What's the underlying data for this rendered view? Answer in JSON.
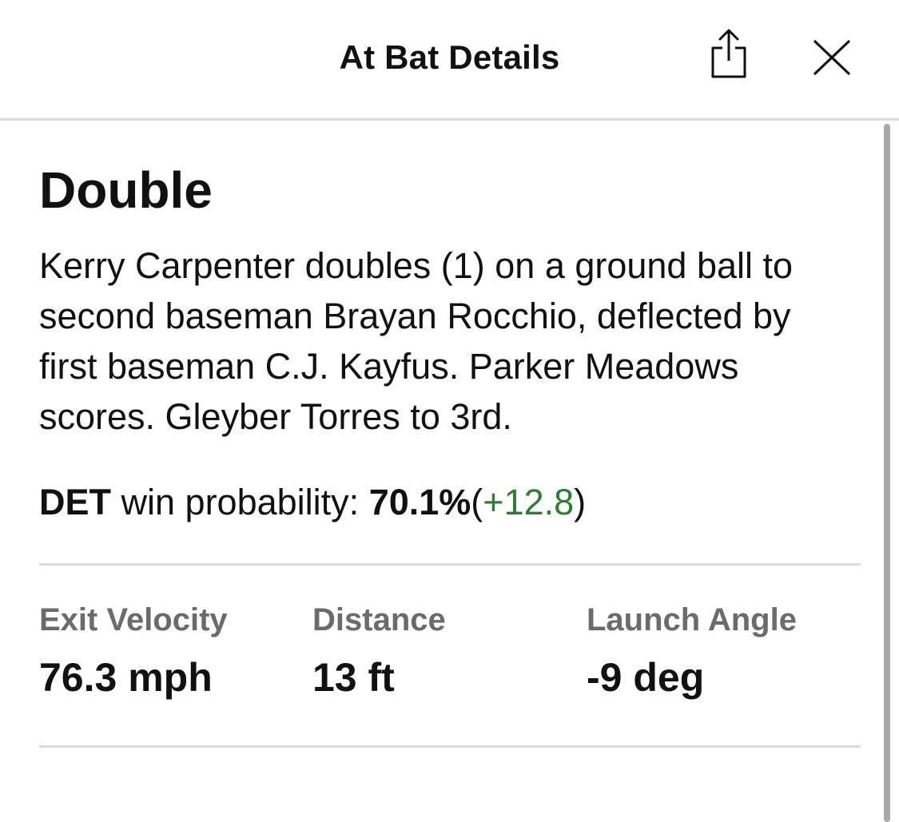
{
  "header": {
    "title": "At Bat Details",
    "share_icon": "share-icon",
    "close_icon": "close-icon"
  },
  "play": {
    "title": "Double",
    "description": "Kerry Carpenter doubles (1) on a ground ball to second baseman Brayan Rocchio, deflected by first baseman C.J. Kayfus. Parker Meadows scores. Gleyber Torres to 3rd."
  },
  "win_probability": {
    "team": "DET",
    "label": "win probability:",
    "percent": "70.1%",
    "open_paren": "(",
    "delta": "+12.8",
    "close_paren": ")",
    "delta_color": "#2e7d32"
  },
  "stats": [
    {
      "label": "Exit Velocity",
      "value": "76.3 mph"
    },
    {
      "label": "Distance",
      "value": "13 ft"
    },
    {
      "label": "Launch Angle",
      "value": "-9 deg"
    }
  ]
}
